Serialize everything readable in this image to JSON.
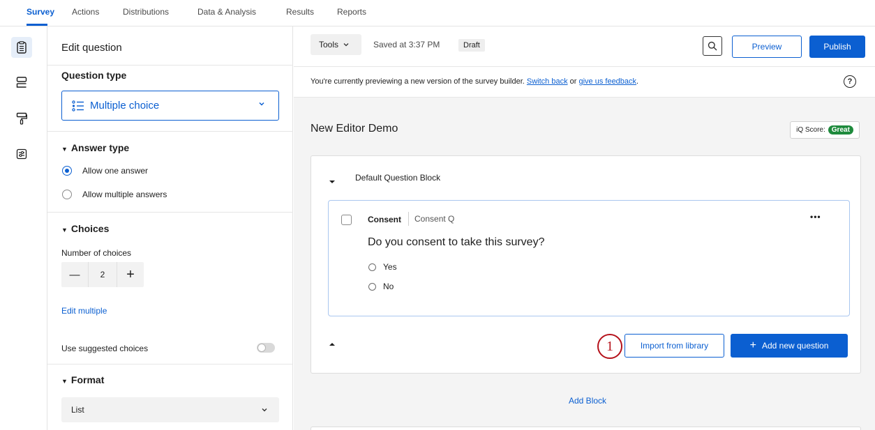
{
  "nav": {
    "tabs": [
      {
        "label": "Survey",
        "active": true
      },
      {
        "label": "Actions"
      },
      {
        "label": "Distributions"
      },
      {
        "label": "Data & Analysis"
      },
      {
        "label": "Results"
      },
      {
        "label": "Reports"
      }
    ]
  },
  "rail": {
    "icons": [
      "survey-icon",
      "blocks-icon",
      "look-and-feel-icon",
      "options-icon"
    ]
  },
  "panel": {
    "heading": "Edit question",
    "question_type_label": "Question type",
    "question_type_value": "Multiple choice",
    "answer_type": {
      "title": "Answer type",
      "options": [
        {
          "label": "Allow one answer",
          "selected": true
        },
        {
          "label": "Allow multiple answers",
          "selected": false
        }
      ]
    },
    "choices": {
      "title": "Choices",
      "number_label": "Number of choices",
      "minus": "—",
      "count": "2",
      "plus": "+",
      "edit_multiple": "Edit multiple"
    },
    "suggested_choices": {
      "label": "Use suggested choices",
      "enabled": false
    },
    "format": {
      "title": "Format",
      "value": "List"
    }
  },
  "toolbar": {
    "tools_label": "Tools",
    "saved_text": "Saved at 3:37 PM",
    "draft_label": "Draft",
    "preview_label": "Preview",
    "publish_label": "Publish"
  },
  "notice": {
    "text": "You're currently previewing a new version of the survey builder.",
    "switch_back": "Switch back",
    "or": "or",
    "feedback": "give us feedback",
    "end": ".",
    "help": "?"
  },
  "survey": {
    "title": "New Editor Demo",
    "iq_label": "iQ Score:",
    "iq_value": "Great"
  },
  "block": {
    "title": "Default Question Block",
    "question": {
      "id": "Consent",
      "label": "Consent Q",
      "text": "Do you consent to take this survey?",
      "more": "•••",
      "choices": [
        "Yes",
        "No"
      ]
    },
    "callout_number": "1",
    "import_label": "Import from library",
    "add_question_plus": "+",
    "add_question_label": "Add new question"
  },
  "add_block_label": "Add Block",
  "colors": {
    "accent": "#0b5fd1",
    "callout": "#b5121b",
    "iq_great": "#1e8a3c"
  }
}
